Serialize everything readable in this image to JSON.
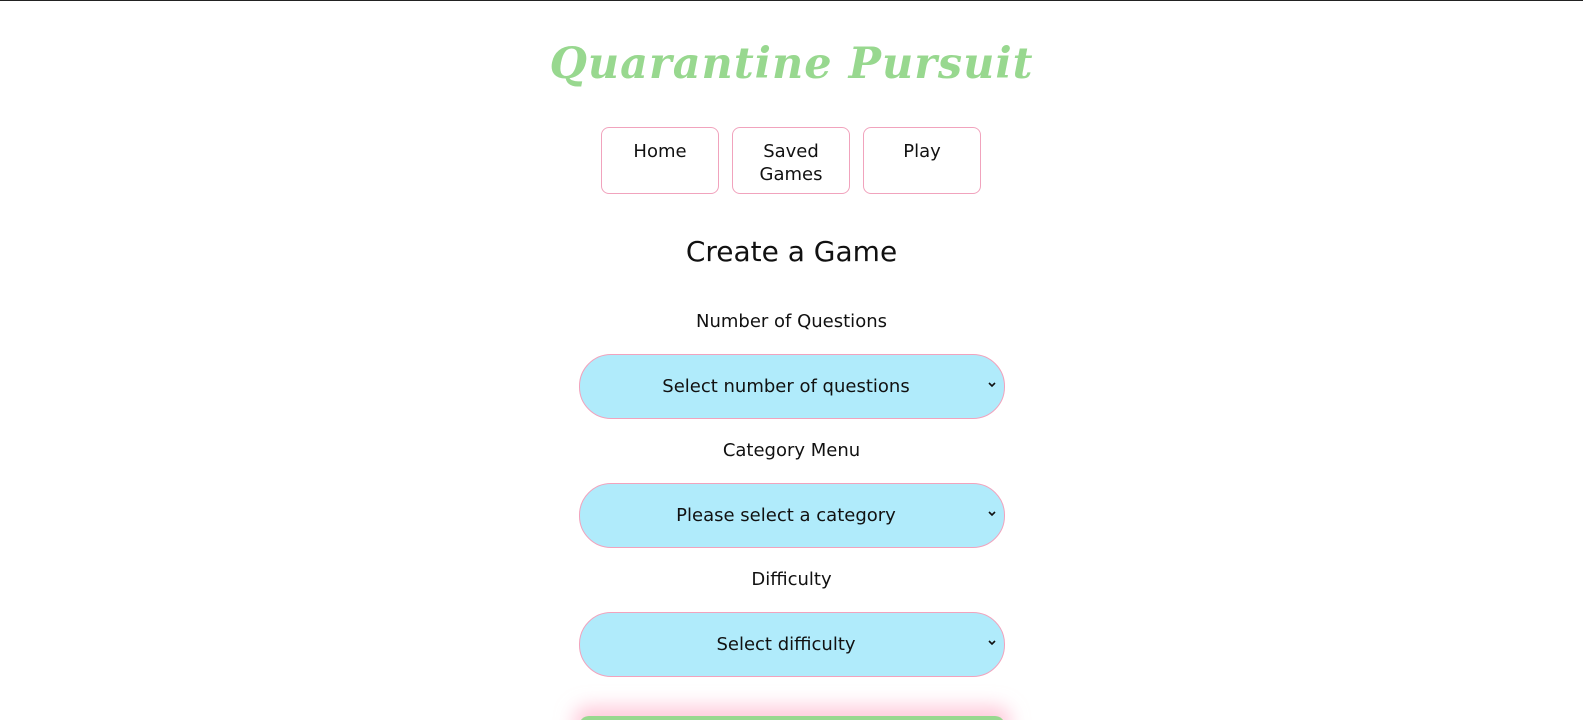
{
  "app": {
    "title": "Quarantine Pursuit"
  },
  "nav": {
    "items": [
      {
        "label": "Home"
      },
      {
        "label": "Saved Games"
      },
      {
        "label": "Play"
      }
    ]
  },
  "main": {
    "heading": "Create a Game",
    "fields": [
      {
        "label": "Number of Questions",
        "selected": "Select number of questions"
      },
      {
        "label": "Category Menu",
        "selected": "Please select a category"
      },
      {
        "label": "Difficulty",
        "selected": "Select difficulty"
      }
    ]
  },
  "colors": {
    "title": "#98d88f",
    "border": "#f1a3bd",
    "select_bg": "#b0ebfb",
    "submit": "#98d88f"
  },
  "icons": {
    "dropdown": "chevron-down-icon"
  }
}
